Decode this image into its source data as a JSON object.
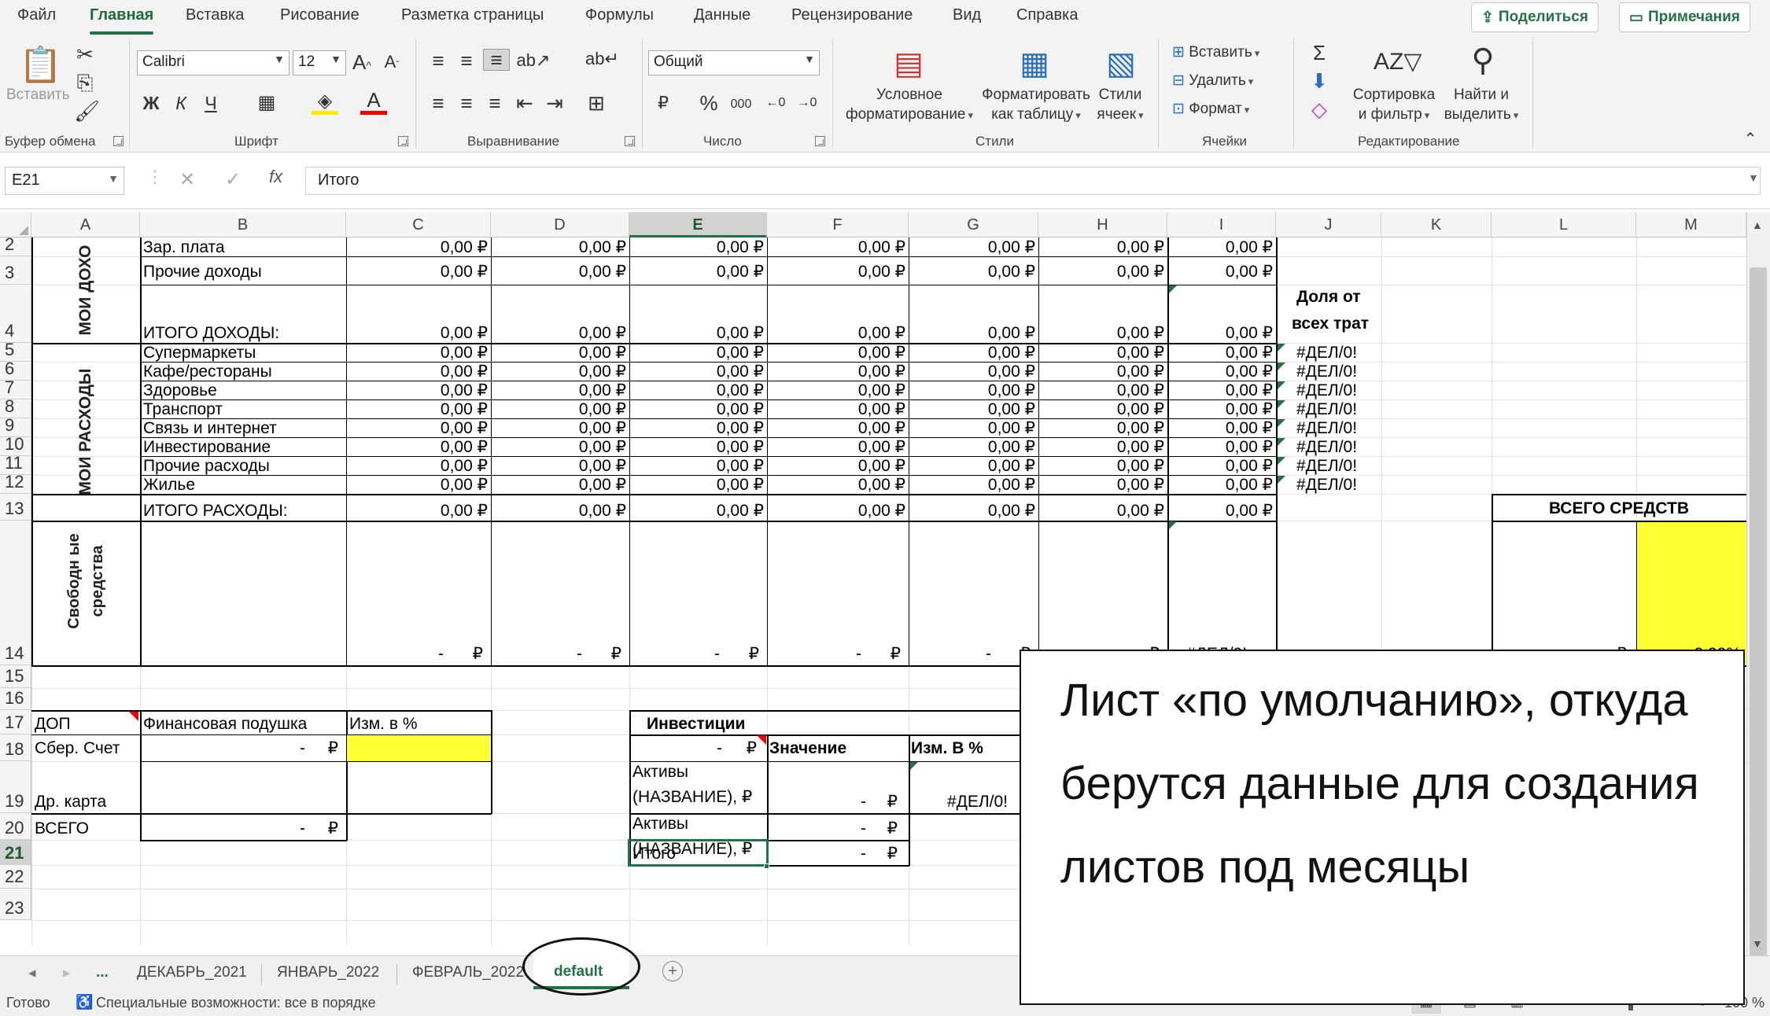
{
  "ribbon_tabs": [
    "Файл",
    "Главная",
    "Вставка",
    "Рисование",
    "Разметка страницы",
    "Формулы",
    "Данные",
    "Рецензирование",
    "Вид",
    "Справка"
  ],
  "share_label": "Поделиться",
  "notes_label": "Примечания",
  "groups": {
    "clipboard": "Буфер обмена",
    "font": "Шрифт",
    "alignment": "Выравнивание",
    "number": "Число",
    "styles": "Стили",
    "cells": "Ячейки",
    "editing": "Редактирование"
  },
  "clipboard": {
    "paste": "Вставить"
  },
  "font": {
    "name": "Calibri",
    "size": "12",
    "bold": "Ж",
    "italic": "К",
    "underline": "Ч"
  },
  "number": {
    "format": "Общий"
  },
  "styles": {
    "cond1": "Условное",
    "cond2": "форматирование",
    "table1": "Форматировать",
    "table2": "как таблицу",
    "cell1": "Стили",
    "cell2": "ячеек"
  },
  "cells": {
    "insert": "Вставить",
    "delete": "Удалить",
    "format": "Формат"
  },
  "editing": {
    "sort1": "Сортировка",
    "sort2": "и фильтр",
    "find1": "Найти и",
    "find2": "выделить"
  },
  "formula_bar": {
    "name_box": "E21",
    "formula": "Итого"
  },
  "columns": [
    "A",
    "B",
    "C",
    "D",
    "E",
    "F",
    "G",
    "H",
    "I",
    "J",
    "K",
    "L",
    "M"
  ],
  "rows": [
    "2",
    "3",
    "4",
    "5",
    "6",
    "7",
    "8",
    "9",
    "10",
    "11",
    "12",
    "13",
    "14",
    "15",
    "16",
    "17",
    "18",
    "19",
    "20",
    "21",
    "22",
    "23"
  ],
  "sheet": {
    "income_side": "МОИ ДОХО",
    "expense_side": "МОИ РАСХОДЫ",
    "free_funds": "Свободн ые средства",
    "income_items": [
      "Зар. плата",
      "Прочие доходы"
    ],
    "income_total": "ИТОГО ДОХОДЫ:",
    "expense_items": [
      "Супермаркеты",
      "Кафе/рестораны",
      "Здоровье",
      "Транспорт",
      "Связь и интернет",
      "Инвестирование",
      "Прочие расходы",
      "Жилье"
    ],
    "expense_total": "ИТОГО РАСХОДЫ:",
    "money": "0,00 ₽",
    "dash": "-",
    "rub": "₽",
    "share_h1": "Доля от",
    "share_h2": "всех трат",
    "div0": "#ДЕЛ/0!",
    "total_funds": "ВСЕГО СРЕДСТВ",
    "pct": "0,00%",
    "dop": "ДОП",
    "fin_cushion": "Финансовая подушка",
    "change_pct": "Изм. в %",
    "sber": "Сбер. Счет",
    "other_card": "Др. карта",
    "total": "ВСЕГО",
    "investments": "Инвестиции",
    "value": "Значение",
    "change_pct2": "Изм. В %",
    "asset": "Активы (НАЗВАНИЕ), ₽",
    "asset1": "Активы",
    "asset2": "(НАЗВАНИЕ), ₽",
    "itogo": "Итого"
  },
  "annotation": "Лист «по умолчанию», откуда берутся данные для создания листов под месяцы",
  "sheet_tabs": [
    "...",
    "ДЕКАБРЬ_2021",
    "ЯНВАРЬ_2022",
    "ФЕВРАЛЬ_2022",
    "default"
  ],
  "status": {
    "ready": "Готово",
    "accessibility": "Специальные возможности: все в порядке",
    "zoom": "100 %"
  },
  "colors": {
    "accent": "#217346",
    "highlight": "#ffff33"
  }
}
